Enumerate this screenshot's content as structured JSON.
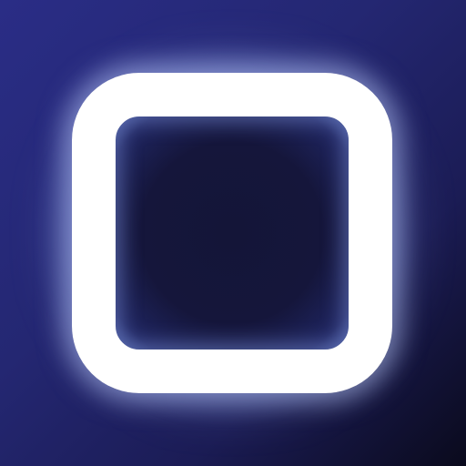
{
  "scene": {
    "icon": "rounded-square-outline-icon",
    "colors": {
      "stroke": "#ffffff",
      "inner": "#15163b",
      "background_primary": "#242772",
      "background_corner": "#0a0a1c",
      "glow": "#c8d7ff"
    }
  }
}
